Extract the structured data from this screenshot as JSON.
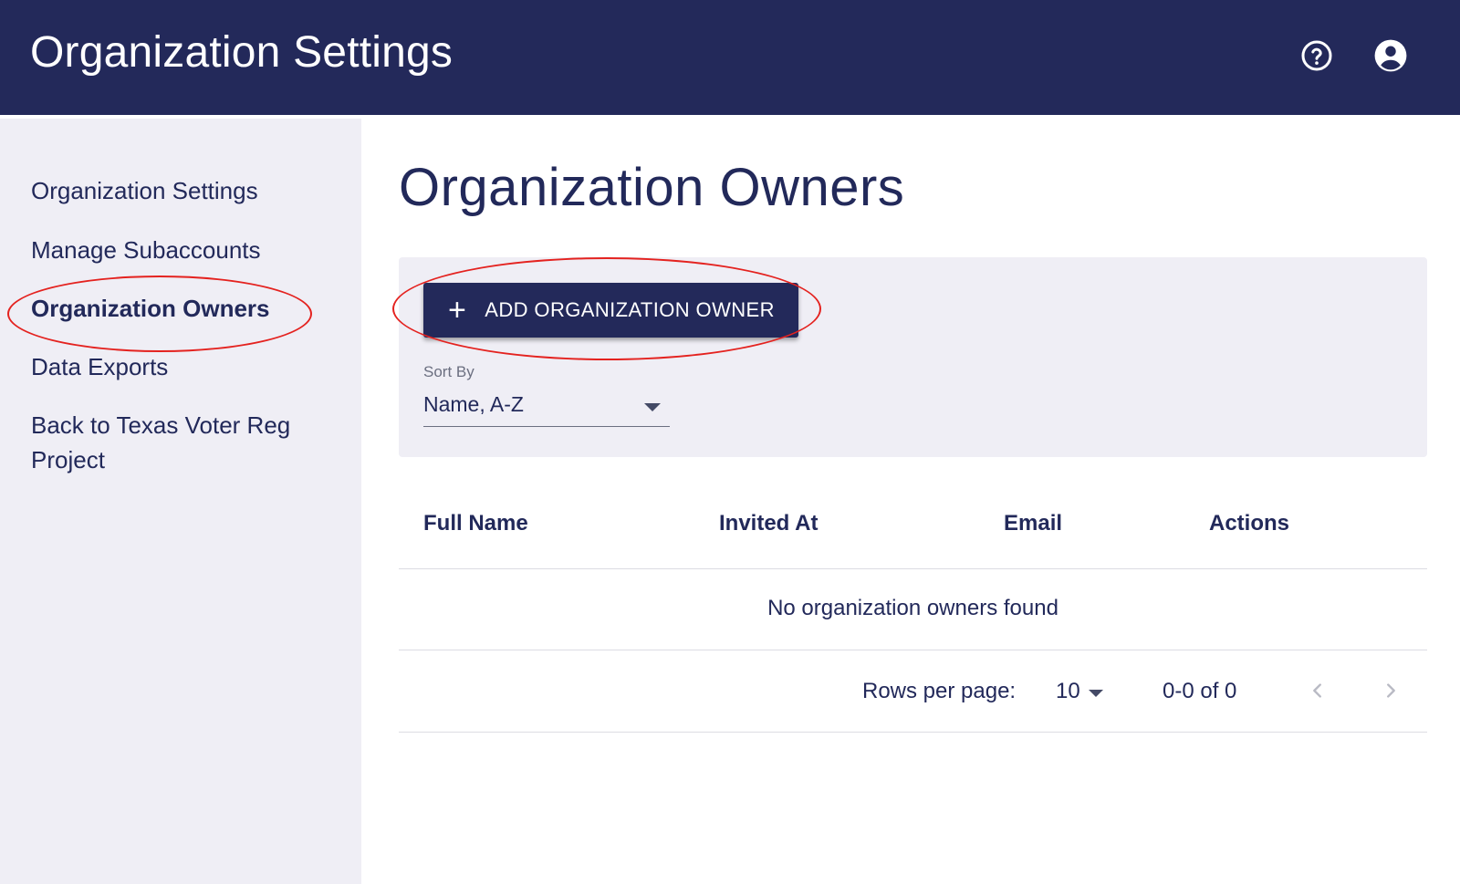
{
  "header": {
    "title": "Organization Settings",
    "help_icon": "help-circle-icon",
    "account_icon": "account-circle-icon"
  },
  "sidebar": {
    "items": [
      {
        "label": "Organization Settings",
        "active": false
      },
      {
        "label": "Manage Subaccounts",
        "active": false
      },
      {
        "label": "Organization Owners",
        "active": true
      },
      {
        "label": "Data Exports",
        "active": false
      },
      {
        "label": "Back to Texas Voter Reg Project",
        "active": false
      }
    ]
  },
  "main": {
    "title": "Organization Owners",
    "add_button_label": "ADD ORGANIZATION OWNER",
    "sort": {
      "label": "Sort By",
      "value": "Name, A-Z"
    },
    "table": {
      "columns": [
        "Full Name",
        "Invited At",
        "Email",
        "Actions"
      ],
      "empty_message": "No organization owners found"
    },
    "pagination": {
      "rows_per_page_label": "Rows per page:",
      "rows_per_page_value": "10",
      "range": "0-0 of 0"
    }
  },
  "colors": {
    "navy": "#23295a",
    "panel": "#efeef5",
    "annotation": "#e4221f"
  }
}
